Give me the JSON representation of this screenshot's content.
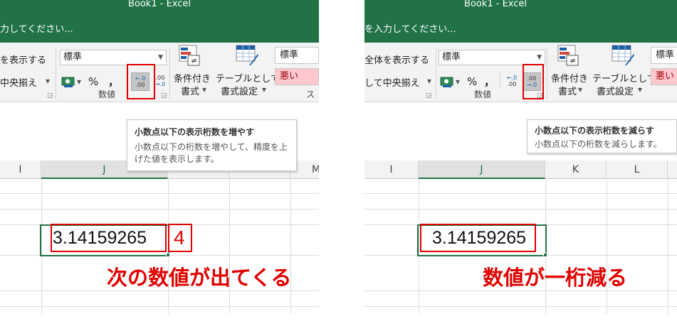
{
  "left": {
    "window_title": "Book1 - Excel",
    "tell_me_placeholder": "力してください...",
    "ribbon": {
      "wrap_text_label": "を表示する",
      "merge_center_label": "中央揃え",
      "number_format_value": "標準",
      "percent_symbol": "%",
      "comma_symbol": "，",
      "currency_arrow": "▾",
      "increase_decimal_top": "←.0",
      "increase_decimal_bottom": ".00",
      "decrease_decimal_top": ".00",
      "decrease_decimal_bottom": "→.0",
      "conditional_format_line1": "条件付き",
      "conditional_format_line2": "書式",
      "format_table_line1": "テーブルとして",
      "format_table_line2": "書式設定",
      "dropdown_arrow": "▾",
      "number_group_label": "数値",
      "style_normal": "標準",
      "style_bad": "悪い",
      "styles_group_label": "ス"
    },
    "tooltip": {
      "title": "小数点以下の表示桁数を増やす",
      "description": "小数点以下の桁数を増やして、精度を上げた値を表示します。"
    },
    "columns": [
      "I",
      "J",
      "",
      "",
      "M"
    ],
    "cell_value": "3.14159265",
    "added_digit": "4",
    "annotation": "次の数値が出てくる"
  },
  "right": {
    "window_title": "Book1 - Excel",
    "tell_me_placeholder": "を入力してください...",
    "ribbon": {
      "wrap_text_label": "全体を表示する",
      "merge_center_label": "して中央揃え",
      "number_format_value": "標準",
      "percent_symbol": "%",
      "comma_symbol": "，",
      "currency_arrow": "▾",
      "increase_decimal_top": "←.0",
      "increase_decimal_bottom": ".00",
      "decrease_decimal_top": ".00",
      "decrease_decimal_bottom": "→.0",
      "conditional_format_line1": "条件付き",
      "conditional_format_line2": "書式",
      "format_table_line1": "テーブルとして",
      "format_table_line2": "書式設定",
      "dropdown_arrow": "▾",
      "number_group_label": "数値",
      "style_normal": "標準",
      "style_bad": "悪い"
    },
    "tooltip": {
      "title": "小数点以下の表示桁数を減らす",
      "description": "小数点以下の桁数を減らします。"
    },
    "columns": [
      "I",
      "J",
      "K",
      "L"
    ],
    "cell_value": "3.14159265",
    "annotation": "数値が一桁減る"
  },
  "colors": {
    "excel_green": "#217346",
    "annotation_red": "#e00000",
    "ribbon_bg": "#f3f3f3",
    "bad_style_text": "#9c0006",
    "bad_style_bg": "#ffc7ce"
  },
  "icons": {
    "currency": "currency-format-icon",
    "conditional_formatting": "conditional-formatting-icon",
    "format_as_table": "format-as-table-icon",
    "launcher": "dialog-launcher-icon"
  }
}
